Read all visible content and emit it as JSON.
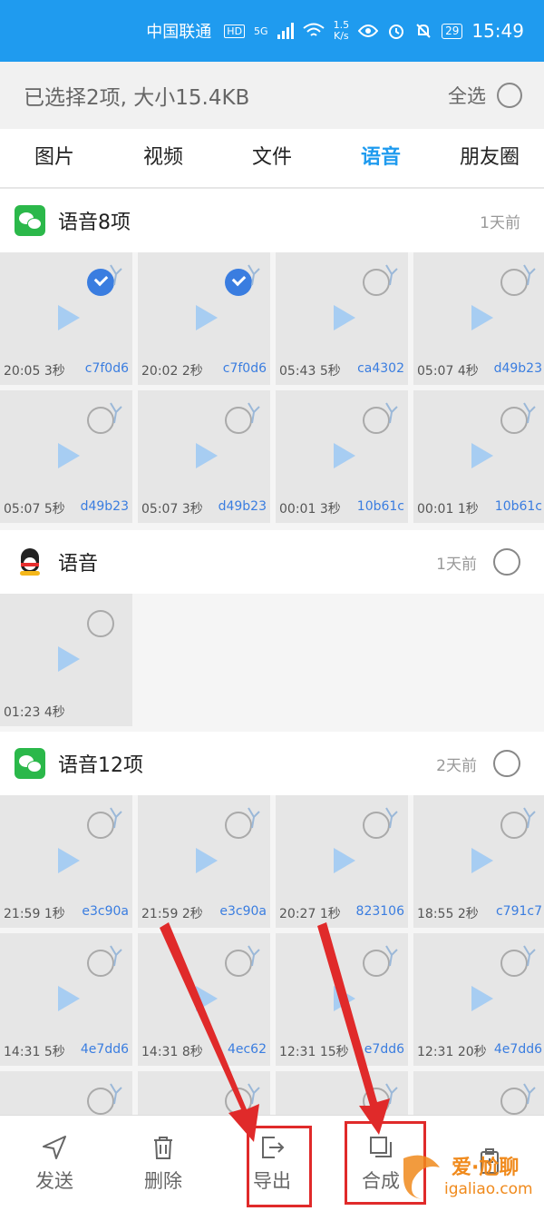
{
  "status_bar": {
    "carrier": "中国联通",
    "hd": "HD",
    "network": "5G",
    "speed_value": "1.5",
    "speed_unit": "K/s",
    "battery": "29",
    "time": "15:49"
  },
  "header": {
    "title": "已选择2项, 大小15.4KB",
    "select_all": "全选"
  },
  "tabs": [
    "图片",
    "视频",
    "文件",
    "语音",
    "朋友圈"
  ],
  "active_tab": "语音",
  "groups": [
    {
      "icon": "wechat-icon",
      "title": "语音8项",
      "time": "1天前",
      "items": [
        {
          "time": "20:05",
          "dur": "3秒",
          "id": "c7f0d6",
          "checked": true
        },
        {
          "time": "20:02",
          "dur": "2秒",
          "id": "c7f0d6",
          "checked": true
        },
        {
          "time": "05:43",
          "dur": "5秒",
          "id": "ca4302",
          "checked": false
        },
        {
          "time": "05:07",
          "dur": "4秒",
          "id": "d49b23",
          "checked": false
        },
        {
          "time": "05:07",
          "dur": "5秒",
          "id": "d49b23",
          "checked": false
        },
        {
          "time": "05:07",
          "dur": "3秒",
          "id": "d49b23",
          "checked": false
        },
        {
          "time": "00:01",
          "dur": "3秒",
          "id": "10b61c",
          "checked": false
        },
        {
          "time": "00:01",
          "dur": "1秒",
          "id": "10b61c",
          "checked": false
        }
      ]
    },
    {
      "icon": "qq-icon",
      "title": "语音",
      "time": "1天前",
      "items": [
        {
          "time": "01:23",
          "dur": "4秒",
          "id": "",
          "checked": false
        }
      ]
    },
    {
      "icon": "wechat-icon",
      "title": "语音12项",
      "time": "2天前",
      "items": [
        {
          "time": "21:59",
          "dur": "1秒",
          "id": "e3c90a",
          "checked": false
        },
        {
          "time": "21:59",
          "dur": "2秒",
          "id": "e3c90a",
          "checked": false
        },
        {
          "time": "20:27",
          "dur": "1秒",
          "id": "823106",
          "checked": false
        },
        {
          "time": "18:55",
          "dur": "2秒",
          "id": "c791c7",
          "checked": false
        },
        {
          "time": "14:31",
          "dur": "5秒",
          "id": "4e7dd6",
          "checked": false
        },
        {
          "time": "14:31",
          "dur": "8秒",
          "id": "4ec62",
          "checked": false
        },
        {
          "time": "12:31",
          "dur": "15秒",
          "id": "e7dd6",
          "checked": false
        },
        {
          "time": "12:31",
          "dur": "20秒",
          "id": "4e7dd6",
          "checked": false
        },
        {
          "time": "",
          "dur": "",
          "id": "",
          "checked": false
        },
        {
          "time": "",
          "dur": "",
          "id": "",
          "checked": false
        },
        {
          "time": "",
          "dur": "",
          "id": "",
          "checked": false
        },
        {
          "time": "",
          "dur": "",
          "id": "",
          "checked": false
        }
      ]
    }
  ],
  "toolbar": {
    "send": "发送",
    "delete": "删除",
    "export": "导出",
    "merge": "合成"
  },
  "watermark": {
    "text": "爱·尬聊",
    "url": "igaliao.com"
  },
  "colors": {
    "accent": "#1f9bef",
    "highlight_box": "#e02a2a",
    "hash_text": "#3a7de0"
  }
}
